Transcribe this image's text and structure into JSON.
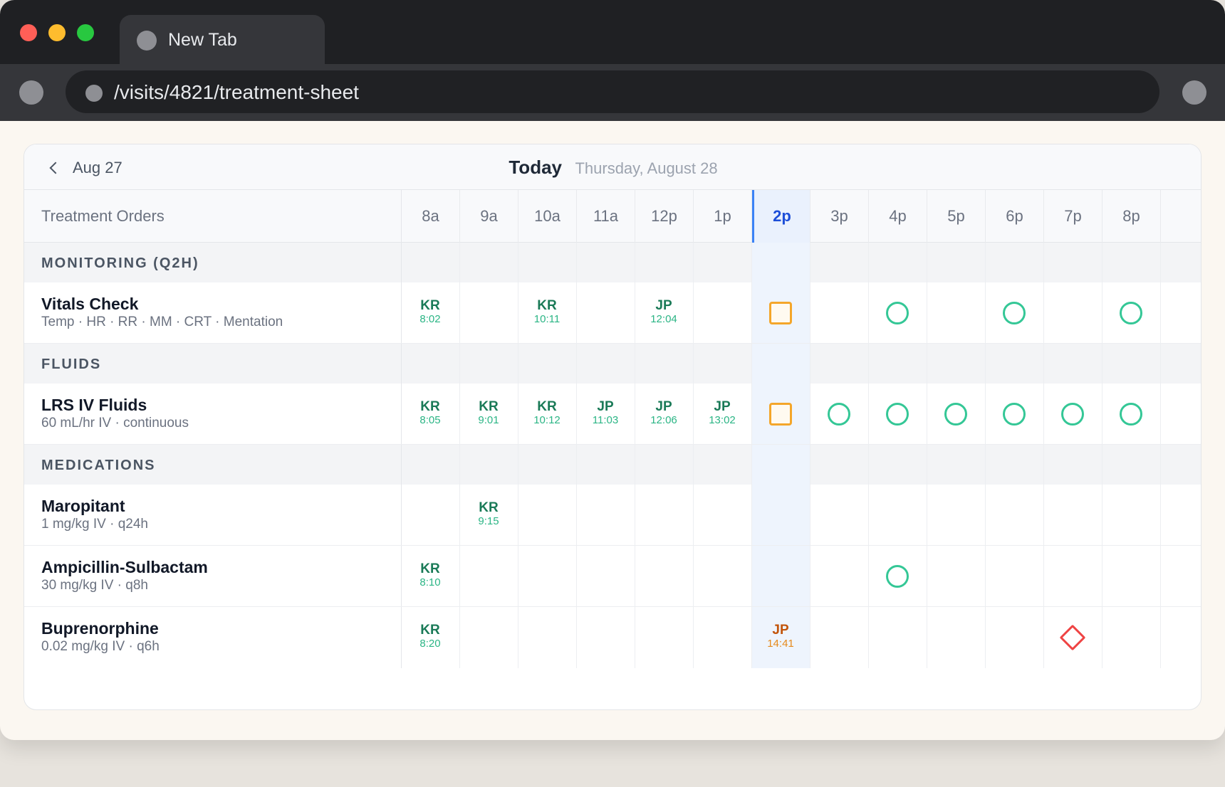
{
  "browser": {
    "tab_title": "New Tab",
    "address": "/visits/4821/treatment-sheet"
  },
  "sheet": {
    "prev_day_label": "Aug 27",
    "today_label": "Today",
    "today_date": "Thursday, August 28",
    "orders_header": "Treatment Orders",
    "hours": [
      "8a",
      "9a",
      "10a",
      "11a",
      "12p",
      "1p",
      "2p",
      "3p",
      "4p",
      "5p",
      "6p",
      "7p",
      "8p"
    ],
    "current_hour": "2p",
    "sections": [
      {
        "label": "MONITORING (Q2H)",
        "orders": [
          {
            "name": "Vitals Check",
            "detail": "Temp · HR · RR · MM · CRT · Mentation",
            "cells": [
              {
                "hour": "8a",
                "status": "done",
                "initials": "KR",
                "time": "8:02"
              },
              {
                "hour": "10a",
                "status": "done",
                "initials": "KR",
                "time": "10:11"
              },
              {
                "hour": "12p",
                "status": "done",
                "initials": "JP",
                "time": "12:04"
              },
              {
                "hour": "2p",
                "status": "due"
              },
              {
                "hour": "4p",
                "status": "scheduled"
              },
              {
                "hour": "6p",
                "status": "scheduled"
              },
              {
                "hour": "8p",
                "status": "scheduled"
              }
            ]
          }
        ]
      },
      {
        "label": "FLUIDS",
        "orders": [
          {
            "name": "LRS IV Fluids",
            "detail": "60 mL/hr IV · continuous",
            "cells": [
              {
                "hour": "8a",
                "status": "done",
                "initials": "KR",
                "time": "8:05"
              },
              {
                "hour": "9a",
                "status": "done",
                "initials": "KR",
                "time": "9:01"
              },
              {
                "hour": "10a",
                "status": "done",
                "initials": "KR",
                "time": "10:12"
              },
              {
                "hour": "11a",
                "status": "done",
                "initials": "JP",
                "time": "11:03"
              },
              {
                "hour": "12p",
                "status": "done",
                "initials": "JP",
                "time": "12:06"
              },
              {
                "hour": "1p",
                "status": "done",
                "initials": "JP",
                "time": "13:02"
              },
              {
                "hour": "2p",
                "status": "due"
              },
              {
                "hour": "3p",
                "status": "scheduled"
              },
              {
                "hour": "4p",
                "status": "scheduled"
              },
              {
                "hour": "5p",
                "status": "scheduled"
              },
              {
                "hour": "6p",
                "status": "scheduled"
              },
              {
                "hour": "7p",
                "status": "scheduled"
              },
              {
                "hour": "8p",
                "status": "scheduled"
              }
            ]
          }
        ]
      },
      {
        "label": "MEDICATIONS",
        "orders": [
          {
            "name": "Maropitant",
            "detail": "1 mg/kg IV · q24h",
            "cells": [
              {
                "hour": "9a",
                "status": "done",
                "initials": "KR",
                "time": "9:15"
              }
            ]
          },
          {
            "name": "Ampicillin-Sulbactam",
            "detail": "30 mg/kg IV · q8h",
            "cells": [
              {
                "hour": "8a",
                "status": "done",
                "initials": "KR",
                "time": "8:10"
              },
              {
                "hour": "4p",
                "status": "scheduled"
              }
            ]
          },
          {
            "name": "Buprenorphine",
            "detail": "0.02 mg/kg IV · q6h",
            "cells": [
              {
                "hour": "8a",
                "status": "done",
                "initials": "KR",
                "time": "8:20"
              },
              {
                "hour": "2p",
                "status": "late",
                "initials": "JP",
                "time": "14:41"
              },
              {
                "hour": "7p",
                "status": "missed"
              }
            ]
          }
        ]
      }
    ]
  },
  "colors": {
    "done_text": "#1a7a57",
    "scheduled": "#34c796",
    "due": "#f4a62a",
    "late_text": "#c2540a",
    "missed": "#ef4444",
    "current_hour": "#3b82f6"
  }
}
